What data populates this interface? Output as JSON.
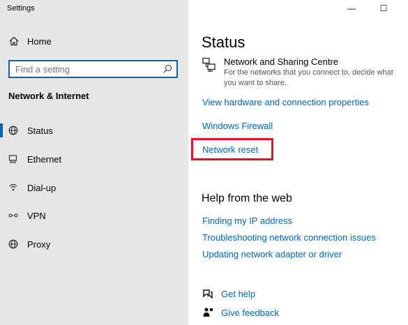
{
  "window": {
    "title": "Settings",
    "minimize_glyph": "—",
    "maximize_glyph": "☐"
  },
  "sidebar": {
    "home_label": "Home",
    "search_placeholder": "Find a setting",
    "section_heading": "Network & Internet",
    "items": [
      {
        "label": "Status",
        "icon": "globe-icon",
        "active": true
      },
      {
        "label": "Ethernet",
        "icon": "ethernet-icon",
        "active": false
      },
      {
        "label": "Dial-up",
        "icon": "dialup-icon",
        "active": false
      },
      {
        "label": "VPN",
        "icon": "vpn-icon",
        "active": false
      },
      {
        "label": "Proxy",
        "icon": "globe-icon",
        "active": false
      }
    ]
  },
  "main": {
    "title": "Status",
    "network_sharing": {
      "title": "Network and Sharing Centre",
      "description": "For the networks that you connect to, decide what you want to share."
    },
    "links": [
      "View hardware and connection properties",
      "Windows Firewall",
      "Network reset"
    ],
    "help_heading": "Help from the web",
    "help_links": [
      "Finding my IP address",
      "Troubleshooting network connection issues",
      "Updating network adapter or driver"
    ],
    "get_help": "Get help",
    "give_feedback": "Give feedback"
  },
  "colors": {
    "accent": "#0063b1",
    "link": "#0067b8",
    "highlight": "#e81123",
    "sidebar_bg": "#e6e6e6"
  }
}
